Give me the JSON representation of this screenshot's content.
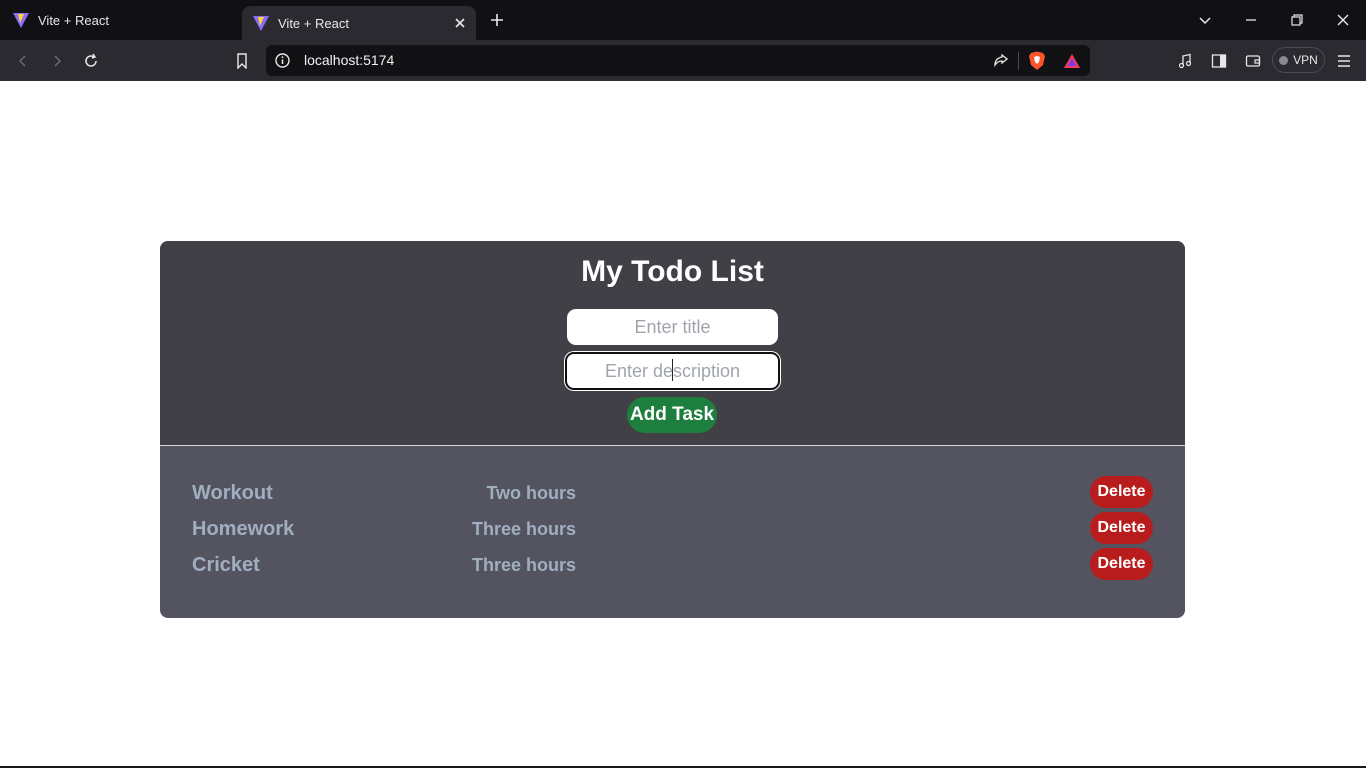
{
  "browser": {
    "tabs": [
      {
        "title": "Vite + React",
        "active": false
      },
      {
        "title": "Vite + React",
        "active": true
      }
    ],
    "url": "localhost:5174",
    "vpn_label": "VPN"
  },
  "app": {
    "heading": "My Todo List",
    "title_placeholder": "Enter title",
    "description_placeholder": "Enter description",
    "add_button": "Add Task",
    "tasks": [
      {
        "title": "Workout",
        "description": "Two hours",
        "delete_label": "Delete"
      },
      {
        "title": "Homework",
        "description": "Three hours",
        "delete_label": "Delete"
      },
      {
        "title": "Cricket",
        "description": "Three hours",
        "delete_label": "Delete"
      }
    ]
  },
  "colors": {
    "card_top": "#404046",
    "card_bottom": "#545460",
    "add_button": "#1e7e3e",
    "delete_button": "#b91c1c",
    "task_text": "#a0aec0"
  },
  "icons": [
    "vite-icon",
    "close-icon",
    "plus-icon",
    "chevron-down-icon",
    "minimize-icon",
    "restore-icon",
    "back-icon",
    "forward-icon",
    "reload-icon",
    "bookmark-icon",
    "info-icon",
    "share-icon",
    "brave-shield-icon",
    "brave-rewards-icon",
    "media-icon",
    "sidebar-icon",
    "wallet-icon",
    "menu-icon"
  ]
}
